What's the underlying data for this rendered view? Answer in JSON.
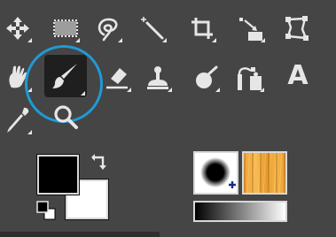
{
  "toolbox": {
    "active_tool": "paintbrush",
    "text_tool_glyph": "A",
    "accent_color": "#1f9ad6",
    "tools_row1": [
      "move-tool-icon",
      "rect-select-tool-icon",
      "lasso-tool-icon",
      "fuzzy-select-tool-icon",
      "crop-tool-icon",
      "unified-transform-tool-icon",
      "cage-transform-tool-icon"
    ],
    "tools_row2": [
      "warp-transform-tool-icon",
      "paintbrush-tool-icon",
      "eraser-tool-icon",
      "clone-tool-icon",
      "smudge-tool-icon",
      "paths-tool-icon",
      "text-tool-icon"
    ],
    "tools_row3": [
      "color-picker-tool-icon",
      "zoom-tool-icon"
    ]
  },
  "colors": {
    "foreground": "#000000",
    "background": "#ffffff"
  },
  "brush_pattern_gradient": {
    "brush": "hardness-brush",
    "pattern": "wood",
    "gradient": "fg-to-bg"
  }
}
